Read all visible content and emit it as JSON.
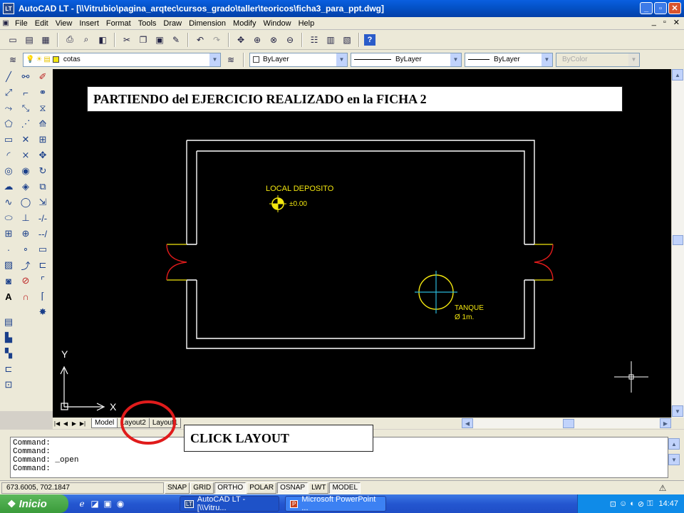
{
  "window": {
    "title": "AutoCAD LT - [\\\\Vitrubio\\pagina_arqtec\\cursos_grado\\taller\\teoricos\\ficha3_para_ppt.dwg]",
    "app_icon_text": "LT",
    "minimize": "_",
    "maximize": "▫",
    "close": "✕"
  },
  "menu": {
    "items": [
      "File",
      "Edit",
      "View",
      "Insert",
      "Format",
      "Tools",
      "Draw",
      "Dimension",
      "Modify",
      "Window",
      "Help"
    ],
    "doc_controls": [
      "_",
      "▫",
      "✕"
    ]
  },
  "layers_toolbar": {
    "layer_name": "cotas",
    "color": "ByLayer",
    "linetype": "ByLayer",
    "lineweight": "ByLayer",
    "plot_style": "ByColor"
  },
  "annotations": {
    "header": "PARTIENDO  del EJERCICIO  REALIZADO  en  la  FICHA 2",
    "click_hint": "CLICK LAYOUT"
  },
  "drawing": {
    "room_label": "LOCAL DEPOSITO",
    "level_mark": "±0.00",
    "tank_label": "TANQUE",
    "tank_diameter": "Ø 1m.",
    "ucs_y": "Y",
    "ucs_x": "X",
    "accent_yellow": "#f2e60f",
    "accent_red": "#e01b1b",
    "line_white": "#ffffff"
  },
  "layout_tabs": {
    "nav": [
      "|◀",
      "◀",
      "▶",
      "▶|"
    ],
    "tabs": [
      "Model",
      "Layout2",
      "Layout1"
    ]
  },
  "command_lines": [
    "Command:",
    "Command:",
    "Command: _open",
    "Command:"
  ],
  "status": {
    "coordinates": "673.6005, 702.1847",
    "buttons": [
      {
        "label": "SNAP",
        "on": false
      },
      {
        "label": "GRID",
        "on": false
      },
      {
        "label": "ORTHO",
        "on": true
      },
      {
        "label": "POLAR",
        "on": false
      },
      {
        "label": "OSNAP",
        "on": true
      },
      {
        "label": "LWT",
        "on": false
      },
      {
        "label": "MODEL",
        "on": true
      }
    ]
  },
  "taskbar": {
    "start_label": "Inicio",
    "tasks": [
      {
        "label": "AutoCAD LT - [\\\\Vitru...",
        "icon": "LT"
      },
      {
        "label": "Microsoft PowerPoint ...",
        "icon": "P"
      }
    ],
    "clock": "14:47"
  }
}
